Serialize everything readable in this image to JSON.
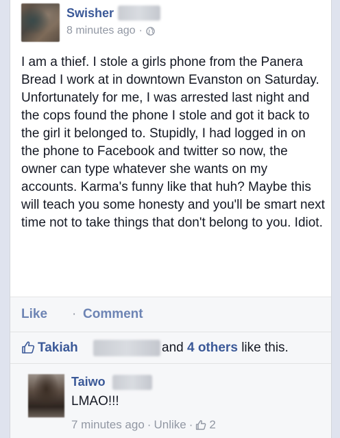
{
  "post": {
    "author": "Swisher",
    "timestamp": "8 minutes ago",
    "meta_sep": "·",
    "body": "I am a thief. I stole a girls phone from the Panera Bread I work at in downtown Evanston on Saturday. Unfortunately for me, I was arrested last night and the cops found the phone I stole and got it back to the girl it belonged to. Stupidly, I had logged in on the phone to Facebook and twitter so now, the owner can type whatever she wants on my accounts. Karma's funny like that huh? Maybe this will teach you some honesty and you'll be smart next time not to take things that don't belong to you. Idiot.",
    "audience_icon": "globe-icon"
  },
  "actions": {
    "like_label": "Like",
    "separator": "·",
    "comment_label": "Comment"
  },
  "likes": {
    "icon": "thumbs-up-icon",
    "first_liker": "Takiah",
    "and_text": "and",
    "others_text": "4 others",
    "suffix": "like this."
  },
  "comment": {
    "author": "Taiwo",
    "text": "LMAO!!!",
    "timestamp": "7 minutes ago",
    "sep1": "·",
    "unlike_label": "Unlike",
    "sep2": "·",
    "like_count": "2",
    "like_icon": "thumbs-up-icon"
  },
  "colors": {
    "link_blue": "#3b5998",
    "muted_blue": "#6d84b4",
    "meta_gray": "#9197a3",
    "page_bg": "#dfe3ee"
  }
}
